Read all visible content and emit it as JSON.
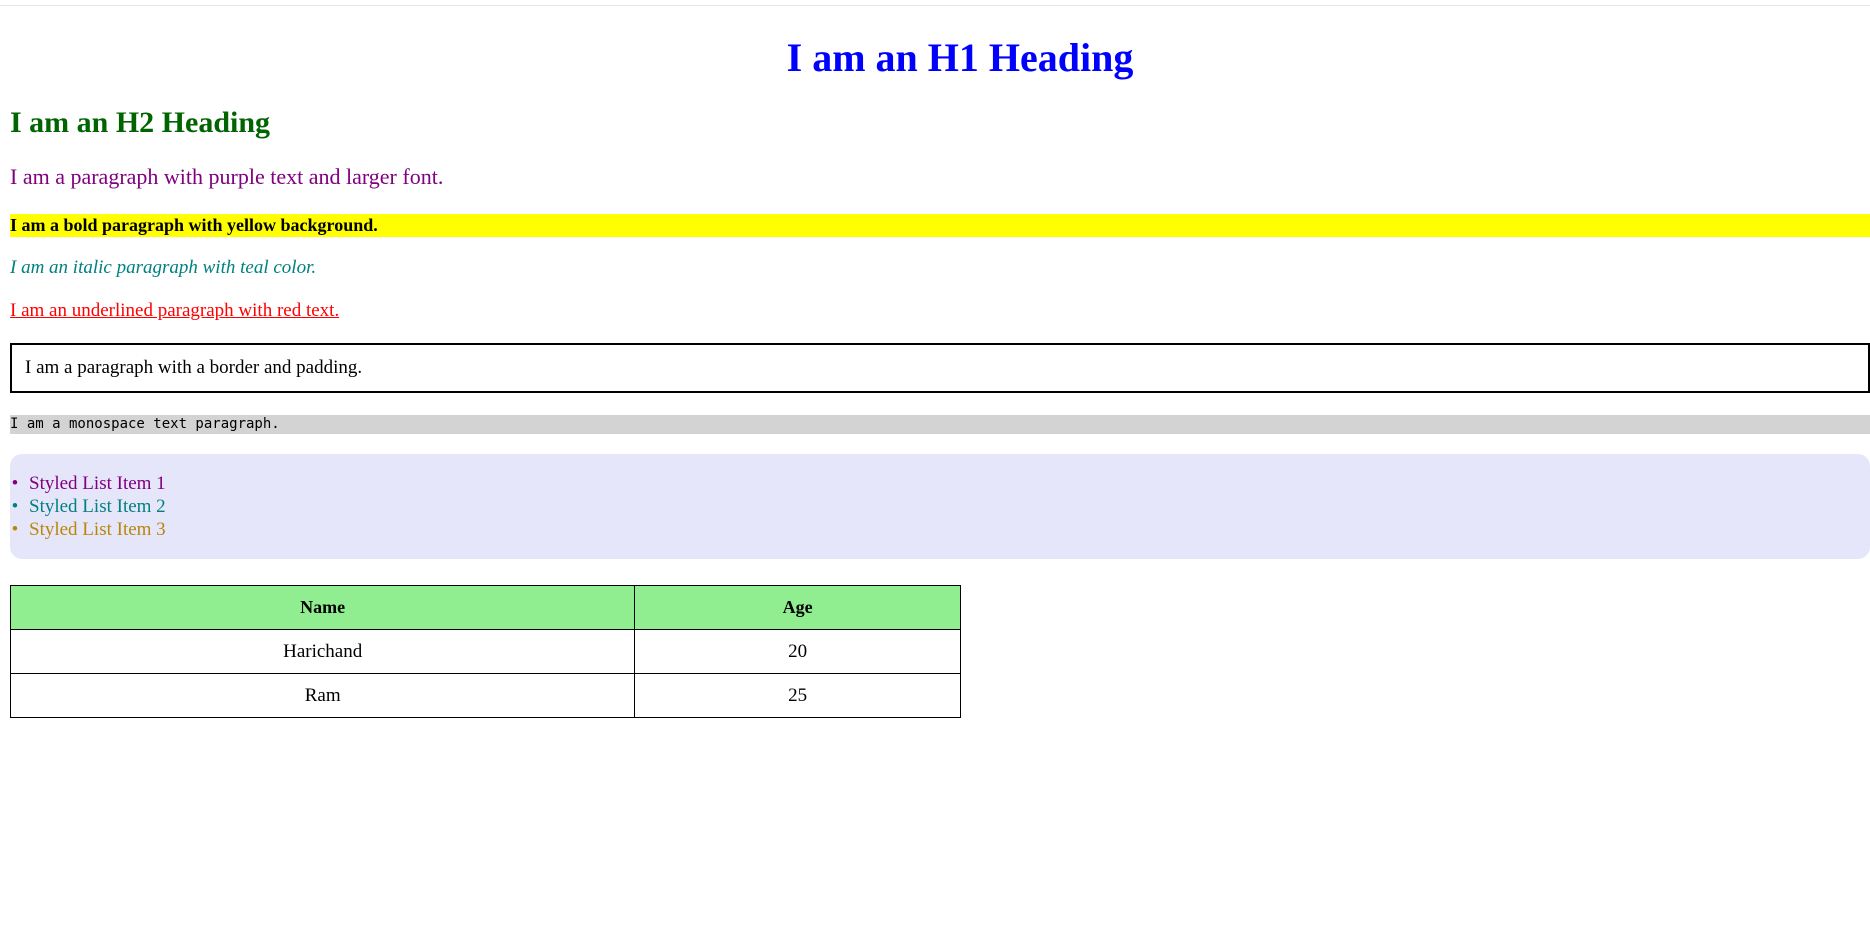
{
  "headings": {
    "h1": "I am an H1 Heading",
    "h2": "I am an H2 Heading"
  },
  "paragraphs": {
    "purple": "I am a paragraph with purple text and larger font.",
    "yellow_bold": "I am a bold paragraph with yellow background.",
    "teal_italic": "I am an italic paragraph with teal color.",
    "red_underlined": "I am an underlined paragraph with red text.",
    "bordered": "I am a paragraph with a border and padding.",
    "monospace": "I am a monospace text paragraph."
  },
  "styled_list": {
    "items": [
      {
        "label": "Styled List Item 1",
        "color": "#800080"
      },
      {
        "label": "Styled List Item 2",
        "color": "#008080"
      },
      {
        "label": "Styled List Item 3",
        "color": "#b8860b"
      }
    ],
    "background": "#e6e6fa"
  },
  "table": {
    "headers": [
      "Name",
      "Age"
    ],
    "rows": [
      [
        "Harichand",
        "20"
      ],
      [
        "Ram",
        "25"
      ]
    ],
    "header_background": "#90ee90"
  },
  "colors": {
    "h1": "#0000ff",
    "h2": "#006400",
    "purple": "#800080",
    "yellow": "#ffff00",
    "teal": "#008080",
    "red": "#ff0000",
    "mono_background": "#d3d3d3"
  }
}
